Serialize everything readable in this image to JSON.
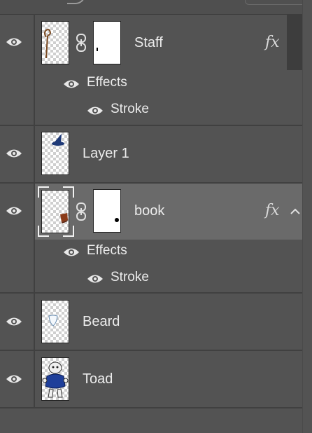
{
  "layers": [
    {
      "name": "Staff",
      "has_mask": true,
      "has_fx": true,
      "effects_label": "Effects",
      "stroke_label": "Stroke",
      "thumb_icon": "staff-thumbnail"
    },
    {
      "name": "Layer 1",
      "has_mask": false,
      "has_fx": false,
      "thumb_icon": "wizard-hat-thumbnail"
    },
    {
      "name": "book",
      "has_mask": true,
      "has_fx": true,
      "selected": true,
      "effects_label": "Effects",
      "stroke_label": "Stroke",
      "thumb_icon": "book-thumbnail"
    },
    {
      "name": "Beard",
      "has_mask": false,
      "has_fx": false,
      "thumb_icon": "beard-thumbnail"
    },
    {
      "name": "Toad",
      "has_mask": false,
      "has_fx": false,
      "thumb_icon": "toad-character-thumbnail"
    }
  ],
  "fx_label": "fx",
  "colors": {
    "panel_bg": "#535353",
    "selected_row_bg": "#6a6a6a",
    "divider": "#404040",
    "text": "#ececec"
  }
}
